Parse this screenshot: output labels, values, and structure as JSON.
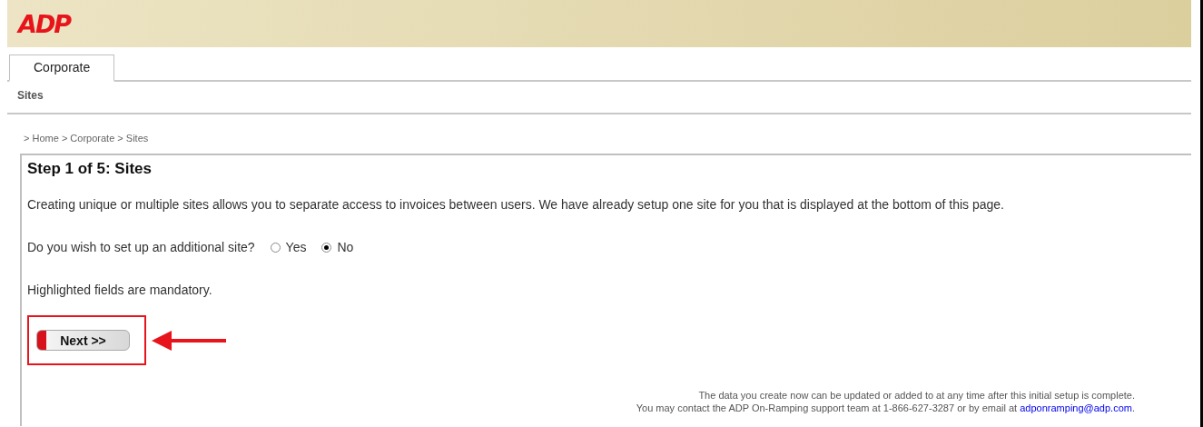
{
  "header": {
    "logo": "ADP"
  },
  "tabs": [
    {
      "label": "Corporate",
      "selected": true
    }
  ],
  "subnav": [
    {
      "label": "Sites",
      "selected": false
    }
  ],
  "breadcrumb": "> Home > Corporate > Sites",
  "step": {
    "title": "Step 1 of 5: Sites",
    "intro": "Creating unique or multiple sites allows you to separate access to invoices between users. We have already setup one site for you that is displayed at the bottom of this page.",
    "question": "Do you wish to set up an additional site?",
    "options": [
      {
        "label": "Yes",
        "selected": false
      },
      {
        "label": "No",
        "selected": true
      }
    ],
    "mandatory_note": "Highlighted fields are mandatory.",
    "next_button": "Next >>"
  },
  "footer": {
    "line_1": "The data you create now can be updated or added to at any time after this initial setup is complete.",
    "line_2": "You may contact the ADP On-Ramping support team at 1-866-627-3287 or by email at ",
    "email": "adponramping@adp.com",
    "line_2_end": "."
  }
}
